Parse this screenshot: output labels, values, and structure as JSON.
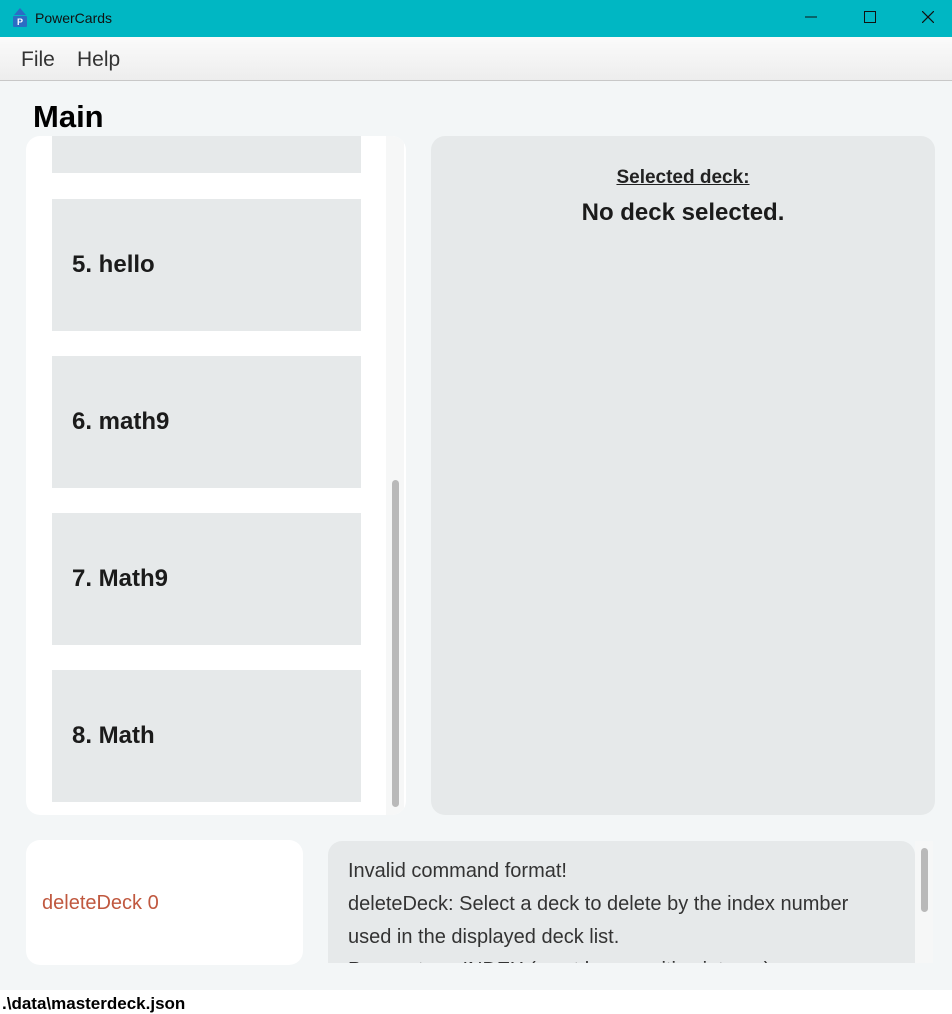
{
  "window": {
    "title": "PowerCards",
    "minimize_icon": "minimize-icon",
    "maximize_icon": "maximize-icon",
    "close_icon": "close-icon"
  },
  "menu": {
    "items": [
      "File",
      "Help"
    ]
  },
  "main": {
    "title": "Main"
  },
  "deck_list": {
    "items": [
      {
        "label": ""
      },
      {
        "label": "5.  hello"
      },
      {
        "label": "6.  math9"
      },
      {
        "label": "7.  Math9"
      },
      {
        "label": "8.  Math"
      }
    ]
  },
  "detail": {
    "selected_label": "Selected deck:",
    "selected_value": "No deck selected."
  },
  "command": {
    "value": "deleteDeck 0"
  },
  "result": {
    "lines": [
      "Invalid command format!",
      "deleteDeck: Select a deck to delete by the index number",
      "used in the displayed deck list.",
      "Parameters: INDEX (must be a positive integer)"
    ]
  },
  "status": {
    "path": ".\\data\\masterdeck.json"
  },
  "colors": {
    "titlebar": "#00b7c3",
    "panel_bg": "#e6e9ea",
    "command_text": "#c0583f"
  }
}
